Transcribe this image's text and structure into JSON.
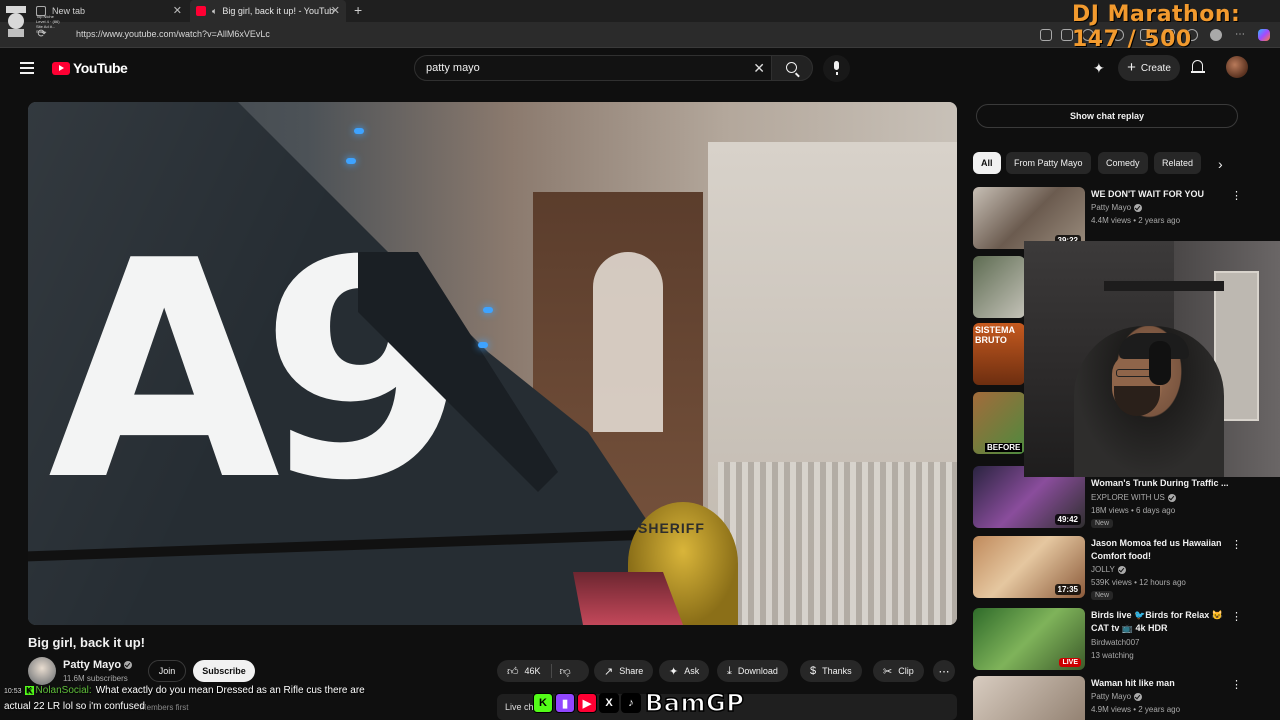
{
  "browser": {
    "tabs": [
      {
        "label": "New tab"
      },
      {
        "label": "Big girl, back it up! - YouTub"
      }
    ],
    "url": "https://www.youtube.com/watch?v=AllM6xVEvLc",
    "streamer_badge_lines": [
      "Top Niche",
      "Level 4 · (86)",
      "Site Ad #...",
      "Stats"
    ]
  },
  "overlay": {
    "marathon": "DJ Marathon:  147 / 500",
    "social_handle": "BamGP",
    "chat": {
      "time": "10:53",
      "user": "NolanSocial:",
      "line1": "What exactly do you mean Dressed as an Rifle cus there are",
      "line2": "actual 22 LR lol so i'm confused",
      "behind_text": "Members first"
    },
    "live_chat_peek": "Live ch"
  },
  "youtube": {
    "logo": "YouTube",
    "search": {
      "value": "patty mayo"
    },
    "create_label": "Create",
    "video": {
      "car_number": "A9",
      "patch_text": "SHERIFF",
      "title": "Big girl, back it up!",
      "channel": "Patty Mayo",
      "subscribers": "11.6M subscribers",
      "join": "Join",
      "subscribe": "Subscribe",
      "likes": "46K",
      "share": "Share",
      "ask": "Ask",
      "download": "Download",
      "thanks": "Thanks",
      "clip": "Clip"
    },
    "sidebar": {
      "chat_replay": "Show chat replay",
      "chips": [
        "All",
        "From Patty Mayo",
        "Comedy",
        "Related"
      ],
      "recommendations": [
        {
          "title": "WE DON'T WAIT FOR YOU",
          "channel": "Patty Mayo",
          "meta": "4.4M views • 2 years ago",
          "duration": "39:22"
        },
        {
          "title": "",
          "channel": "",
          "meta": "",
          "duration": ""
        },
        {
          "title": "",
          "channel": "",
          "meta": "",
          "duration": "",
          "thumb_text": "SISTEMA BRUTO"
        },
        {
          "title": "",
          "channel": "",
          "meta": "",
          "duration": "",
          "thumb_text": "BEFORE"
        },
        {
          "title": "Woman's Trunk During Traffic ...",
          "channel": "EXPLORE WITH US",
          "meta": "18M views • 6 days ago",
          "duration": "49:42",
          "badge": "New"
        },
        {
          "title": "Jason Momoa fed us Hawaiian Comfort food!",
          "channel": "JOLLY",
          "meta": "539K views • 12 hours ago",
          "duration": "17:35",
          "badge": "New"
        },
        {
          "title": "Birds live 🐦Birds for Relax 😺 CAT tv 📺 4k HDR",
          "channel": "Birdwatch007",
          "meta": "13 watching",
          "live": "LIVE"
        },
        {
          "title": "Waman hit like man",
          "channel": "Patty Mayo",
          "meta": "4.9M views • 2 years ago",
          "duration": ""
        }
      ]
    }
  },
  "colors": {
    "yt_red": "#ff0033",
    "marathon_orange": "#f29a2e",
    "kick_green": "#53fc18",
    "twitch_purple": "#9146ff"
  },
  "icons": [
    "menu-icon",
    "search-icon",
    "mic-icon",
    "sparkle-icon",
    "bell-icon",
    "like-icon",
    "dislike-icon",
    "share-icon",
    "ask-icon",
    "download-icon",
    "thanks-icon",
    "clip-icon",
    "more-icon",
    "chevron-right-icon"
  ]
}
